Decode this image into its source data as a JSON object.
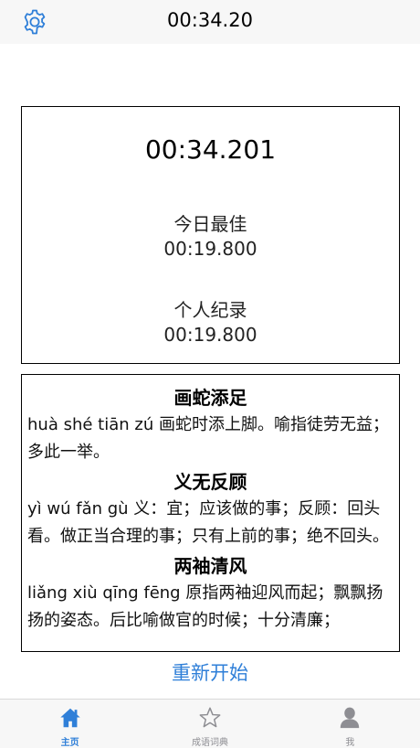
{
  "navbar": {
    "settings_icon": "gear-icon",
    "title": "00:34.20"
  },
  "timer": {
    "current": "00:34.201",
    "today_best_label": "今日最佳",
    "today_best_value": "00:19.800",
    "personal_record_label": "个人纪录",
    "personal_record_value": "00:19.800"
  },
  "idioms": [
    {
      "word": "画蛇添足",
      "description": "huà shé tiān zú 画蛇时添上脚。喻指徒劳无益；多此一举。"
    },
    {
      "word": "义无反顾",
      "description": "yì wú fǎn gù 义：宜；应该做的事；反顾：回头看。做正当合理的事；只有上前的事；绝不回头。"
    },
    {
      "word": "两袖清风",
      "description": "liǎng xiù qīng fēng 原指两袖迎风而起；飘飘扬扬的姿态。后比喻做官的时候；十分清廉；"
    }
  ],
  "restart_label": "重新开始",
  "tabs": [
    {
      "label": "主页",
      "icon": "home-icon",
      "active": true
    },
    {
      "label": "成语词典",
      "icon": "star-icon",
      "active": false
    },
    {
      "label": "我",
      "icon": "person-icon",
      "active": false
    }
  ],
  "colors": {
    "accent": "#2f7fd8",
    "inactive": "#8e8e93",
    "bar_background": "#f7f7f7"
  }
}
